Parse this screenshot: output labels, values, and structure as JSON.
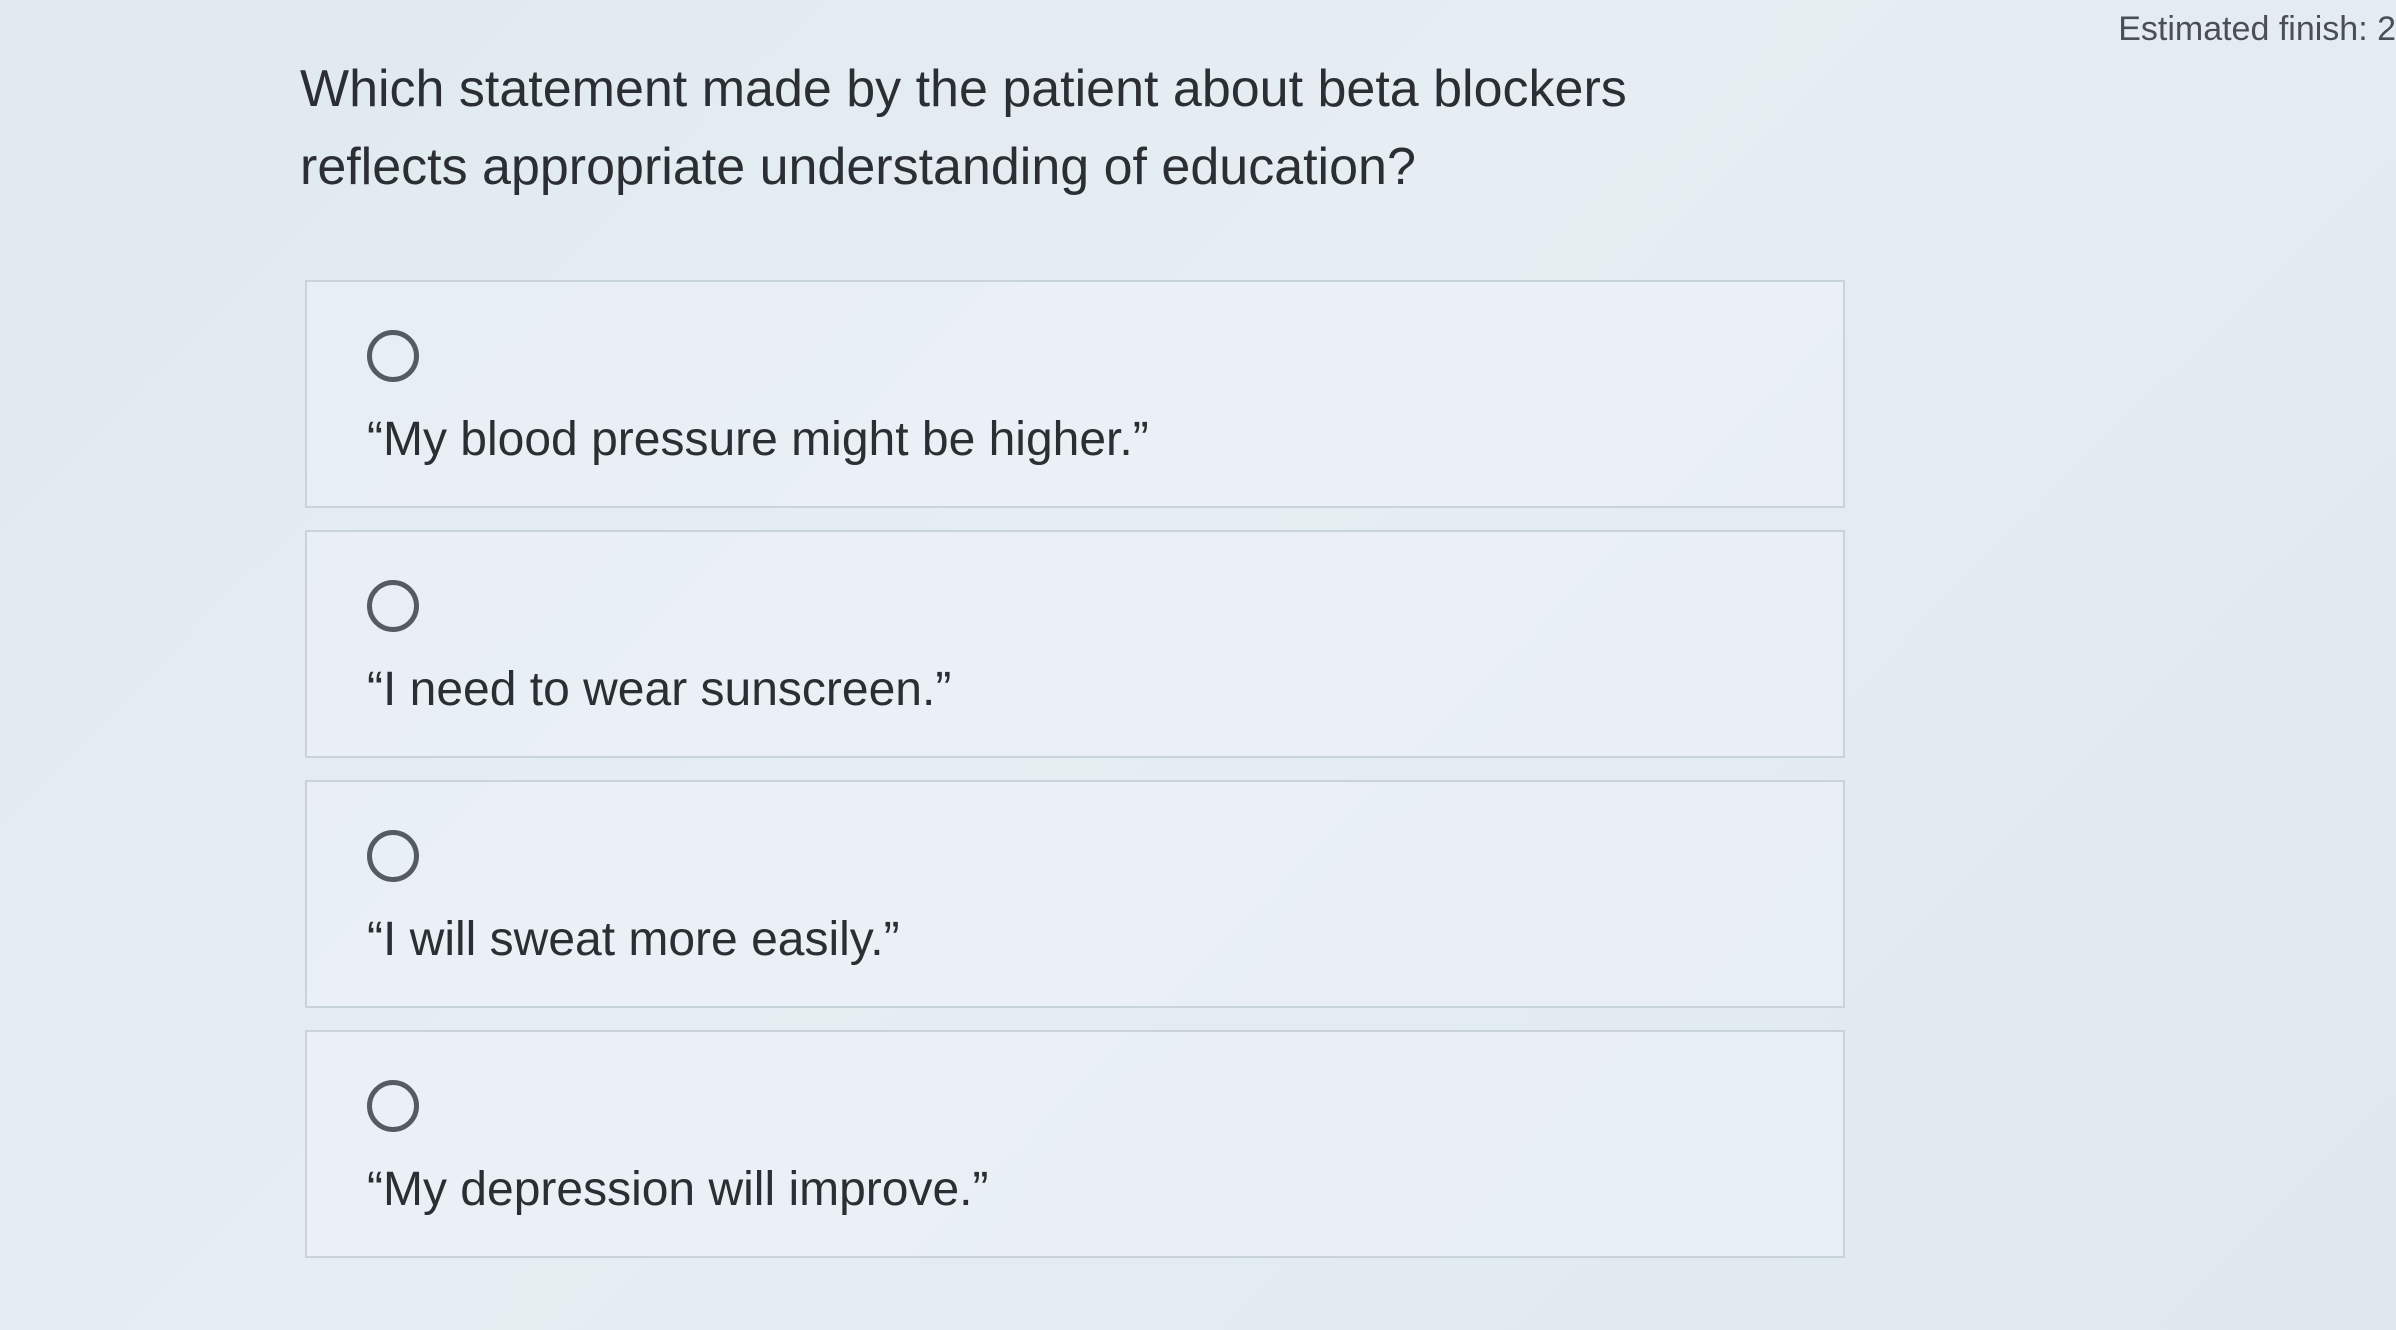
{
  "header": {
    "estimated_finish": "Estimated finish: 2"
  },
  "question": {
    "text": "Which statement made by the patient about beta blockers reflects appropriate understanding of education?"
  },
  "options": [
    {
      "label": "“My blood pressure might be higher.”",
      "selected": false
    },
    {
      "label": "“I need to wear sunscreen.”",
      "selected": false
    },
    {
      "label": "“I will sweat more easily.”",
      "selected": false
    },
    {
      "label": "“My depression will improve.”",
      "selected": false
    }
  ]
}
